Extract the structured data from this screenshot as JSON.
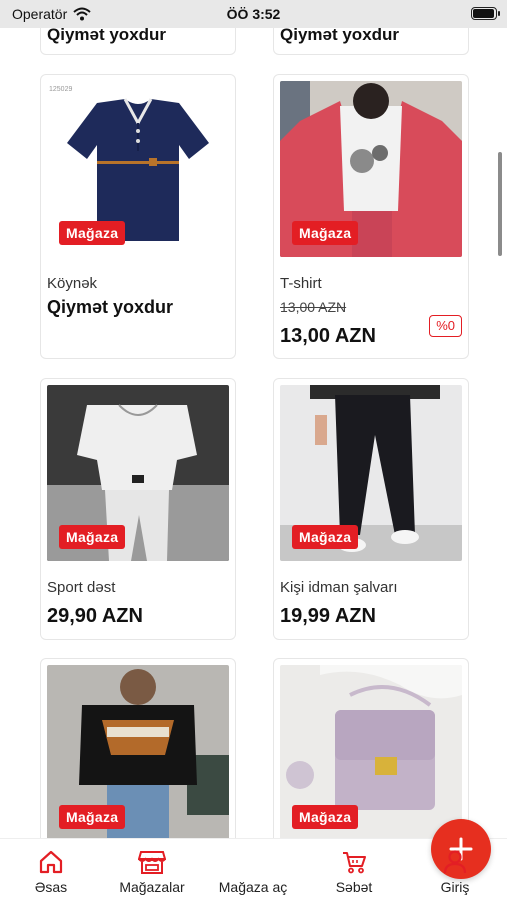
{
  "status_bar": {
    "carrier": "Operatör",
    "time": "ÖÖ 3:52",
    "battery_level": 0.95
  },
  "store_badge": "Mağaza",
  "top_cards": [
    {
      "price": "Qiymət yoxdur"
    },
    {
      "price": "Qiymət yoxdur"
    }
  ],
  "products": [
    {
      "name": "Köynək",
      "price": "Qiymət yoxdur",
      "badge": "Mağaza",
      "image_code": "125029"
    },
    {
      "name": "T-shirt",
      "old_price": "13,00 AZN",
      "price": "13,00 AZN",
      "discount": "%0",
      "badge": "Mağaza"
    },
    {
      "name": "Sport dəst",
      "price": "29,90 AZN",
      "badge": "Mağaza"
    },
    {
      "name": "Kişi idman şalvarı",
      "price": "19,99 AZN",
      "badge": "Mağaza"
    },
    {
      "badge": "Mağaza"
    },
    {
      "badge": "Mağaza"
    }
  ],
  "bottom_nav": {
    "items": [
      {
        "label": "Əsas",
        "icon": "home-icon",
        "active": true
      },
      {
        "label": "Mağazalar",
        "icon": "store-icon",
        "active": false
      },
      {
        "label": "Mağaza aç",
        "icon": "plus-icon",
        "active": false
      },
      {
        "label": "Səbət",
        "icon": "cart-icon",
        "active": false
      },
      {
        "label": "Giriş",
        "icon": "user-icon",
        "active": false
      }
    ]
  },
  "colors": {
    "accent": "#e31e24",
    "fab": "#e62f1f",
    "text": "#111111"
  }
}
